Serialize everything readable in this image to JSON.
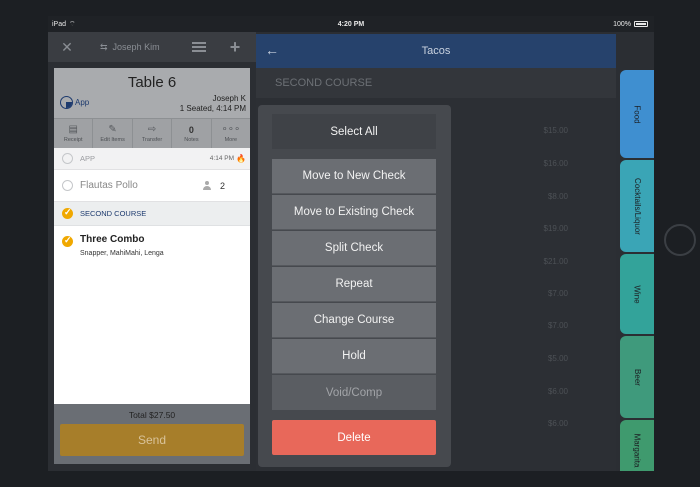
{
  "status_bar": {
    "device": "iPad",
    "time": "4:20 PM",
    "battery": "100%"
  },
  "toolbar": {
    "server_name": "Joseph Kim"
  },
  "table": {
    "title": "Table 6",
    "source": "App",
    "server": "Joseph K",
    "seated": "1 Seated, 4:14 PM",
    "actions": [
      {
        "label": "Receipt",
        "icon": "receipt-icon"
      },
      {
        "label": "Edit Items",
        "icon": "edit-icon"
      },
      {
        "label": "Transfer",
        "icon": "transfer-icon"
      },
      {
        "label": "Notes",
        "count": "0"
      },
      {
        "label": "More",
        "icon": "more-icon"
      }
    ]
  },
  "order": {
    "app_label": "APP",
    "app_time": "4:14 PM",
    "items": [
      {
        "name": "Flautas Pollo",
        "seat": "2"
      }
    ],
    "course_label": "SECOND COURSE",
    "course_items": [
      {
        "name": "Three Combo",
        "modifiers": "Snapper, MahiMahi, Lenga"
      }
    ],
    "total": "Total $27.50",
    "send_label": "Send"
  },
  "menu": {
    "category_title": "Tacos",
    "course_banner": "SECOND COURSE",
    "prices": [
      "$15.00",
      "$16.00",
      "$8.00",
      "$19.00",
      "$21.00",
      "$7.00",
      "$7.00",
      "$5.00",
      "$6.00",
      "$6.00"
    ],
    "tabs": [
      {
        "label": "Food",
        "color": "#3f8fd0"
      },
      {
        "label": "Cocktails/Liquor",
        "color": "#3aa5b6"
      },
      {
        "label": "Wine",
        "color": "#33a39a"
      },
      {
        "label": "Beer",
        "color": "#3f9a7c"
      },
      {
        "label": "Margarita",
        "color": "#3f9a6e"
      }
    ]
  },
  "popup": {
    "select_all": "Select All",
    "actions": [
      {
        "label": "Move to New Check",
        "enabled": true
      },
      {
        "label": "Move to Existing Check",
        "enabled": true
      },
      {
        "label": "Split Check",
        "enabled": true
      },
      {
        "label": "Repeat",
        "enabled": true
      },
      {
        "label": "Change Course",
        "enabled": true
      },
      {
        "label": "Hold",
        "enabled": true
      },
      {
        "label": "Void/Comp",
        "enabled": false
      }
    ],
    "delete": "Delete"
  }
}
